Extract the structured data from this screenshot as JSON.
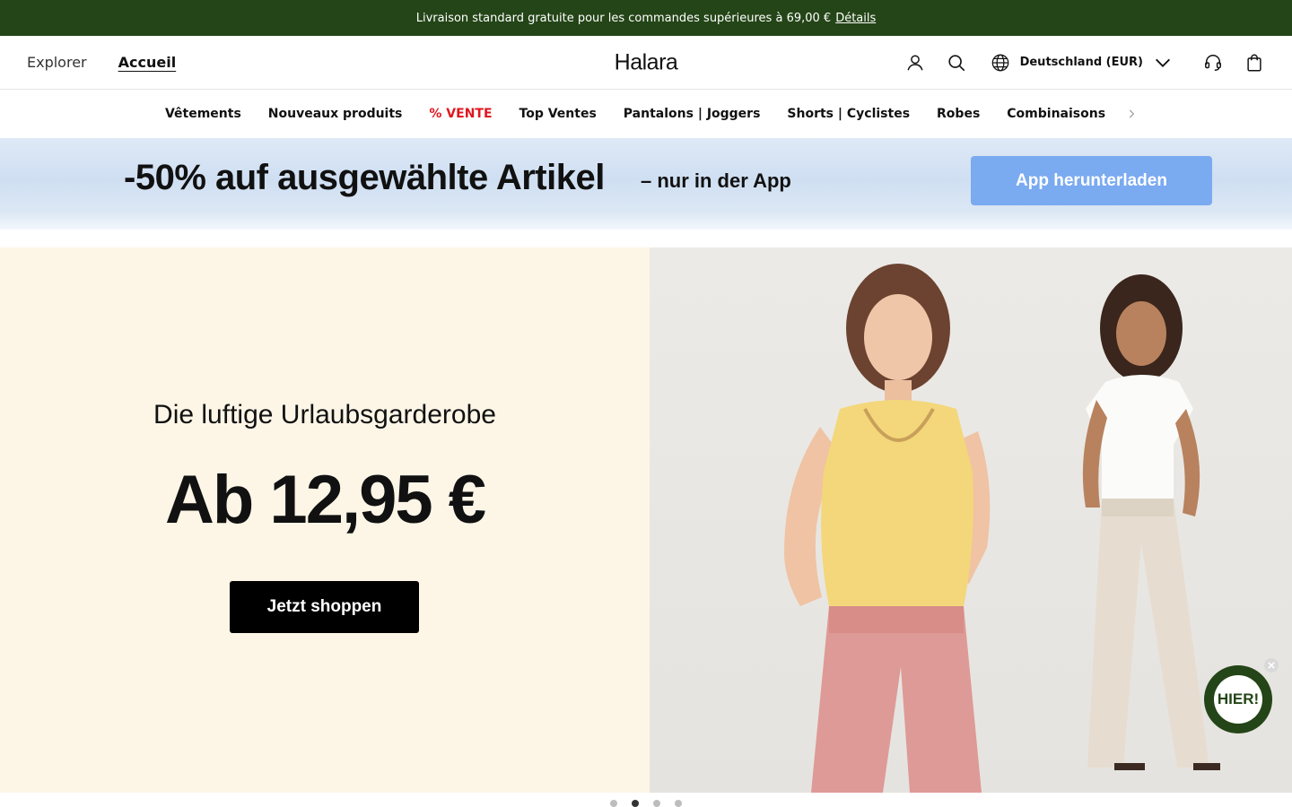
{
  "promo": {
    "text": "Livraison standard gratuite pour les commandes supérieures à 69,00 €",
    "details_label": "Détails"
  },
  "header": {
    "explorer": "Explorer",
    "accueil": "Accueil",
    "logo": "Halara",
    "region": "Deutschland (EUR)"
  },
  "nav": {
    "items": [
      {
        "label": "Vêtements"
      },
      {
        "label": "Nouveaux produits"
      },
      {
        "label": "% VENTE"
      },
      {
        "label": "Top Ventes"
      },
      {
        "label": "Pantalons | Joggers"
      },
      {
        "label": "Shorts | Cyclistes"
      },
      {
        "label": "Robes"
      },
      {
        "label": "Combinaisons"
      }
    ]
  },
  "app_banner": {
    "headline": "-50% auf ausgewählte Artikel",
    "sub": "– nur in der App",
    "cta": "App herunterladen"
  },
  "hero": {
    "tagline": "Die luftige Urlaubsgarderobe",
    "price": "Ab 12,95 €",
    "cta": "Jetzt shoppen"
  },
  "gift": {
    "label": "HIER!"
  },
  "carousel": {
    "total": 4,
    "active": 2
  },
  "colors": {
    "promo_bg": "#244517",
    "sale": "#e0161f",
    "app_cta": "#7aaaf0",
    "hero_bg": "#fdf6e7"
  }
}
